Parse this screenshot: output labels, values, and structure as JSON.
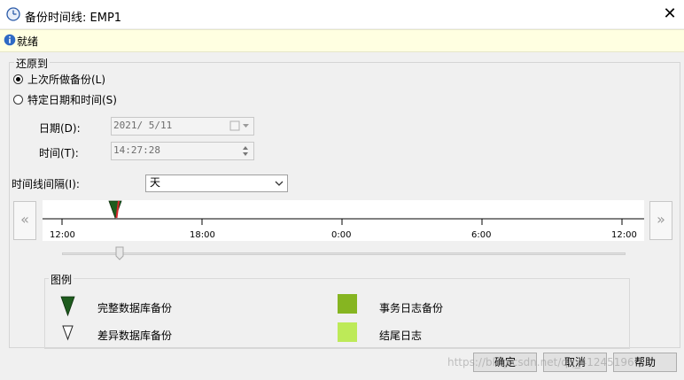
{
  "window": {
    "title": "备份时间线: EMP1"
  },
  "status": {
    "text": "就绪"
  },
  "restore_to": {
    "group_label": "还原到",
    "option_last_backup": "上次所做备份(L)",
    "option_specific": "特定日期和时间(S)",
    "date_label": "日期(D):",
    "date_value": "2021/ 5/11",
    "time_label": "时间(T):",
    "time_value": "14:27:28"
  },
  "interval": {
    "label": "时间线间隔(I):",
    "selected": "天"
  },
  "timeline": {
    "ticks": [
      "12:00",
      "18:00",
      "0:00",
      "6:00",
      "12:00"
    ],
    "prev_label": "«",
    "next_label": "»"
  },
  "legend": {
    "label": "图例",
    "full_backup": "完整数据库备份",
    "diff_backup": "差异数据库备份",
    "log_backup": "事务日志备份",
    "tail_log": "结尾日志"
  },
  "colors": {
    "full_backup": "#1e5c1e",
    "log_backup": "#86b521",
    "tail_log": "#bdea58",
    "marker_red": "#d9262c",
    "status_bg": "#ffffe1"
  },
  "buttons": {
    "ok": "确定",
    "cancel": "取消",
    "help": "帮助"
  },
  "watermark": "https://blog.csdn.net/qq_41245196"
}
